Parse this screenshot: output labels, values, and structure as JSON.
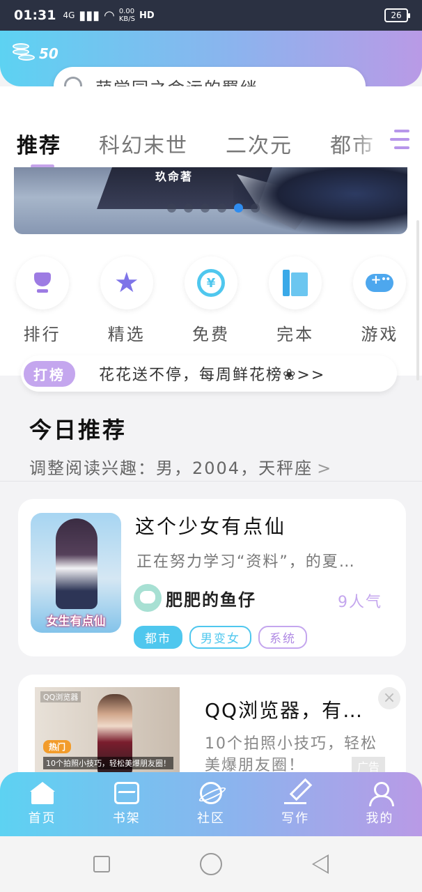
{
  "status_bar": {
    "time": "01:31",
    "network": "4G",
    "speed_value": "0.00",
    "speed_unit": "KB/S",
    "hd": "HD",
    "battery": "26"
  },
  "header": {
    "coins": "50",
    "search_placeholder": "萌学园之命运的羁绊"
  },
  "tabs": [
    {
      "label": "推荐",
      "active": true
    },
    {
      "label": "科幻末世"
    },
    {
      "label": "二次元"
    },
    {
      "label": "都市"
    }
  ],
  "banner": {
    "author_text": "玖命著",
    "dot_count": 6,
    "active_dot": 4
  },
  "quick_links": [
    {
      "label": "排行",
      "icon": "trophy-icon",
      "color": "#9d7be3"
    },
    {
      "label": "精选",
      "icon": "star-icon",
      "color": "#7e74e8"
    },
    {
      "label": "免费",
      "icon": "yuan-icon",
      "color": "#4fc7ee"
    },
    {
      "label": "完本",
      "icon": "book-icon",
      "color": "#3aa9e8"
    },
    {
      "label": "游戏",
      "icon": "gamepad-icon",
      "color": "#4da7ee"
    }
  ],
  "notice": {
    "tag": "打榜",
    "text": "花花送不停，每周鲜花榜❀>>"
  },
  "today": {
    "title": "今日推荐",
    "subtitle": "调整阅读兴趣：男，2004，天秤座",
    "chevron": ">"
  },
  "book_card": {
    "cover_text": "女生有点仙",
    "title": "这个少女有点仙",
    "description": "正在努力学习“资料”，的夏…",
    "author": "肥肥的鱼仔",
    "popularity": "9人气",
    "tags": [
      "都市",
      "男变女",
      "系统"
    ]
  },
  "ad_card": {
    "brand": "QQ浏览器",
    "hot_label": "热门",
    "image_caption": "10个拍照小技巧，轻松美爆朋友圈！",
    "title": "QQ浏览器，有…",
    "description": "10个拍照小技巧，轻松美爆朋友圈！",
    "close": "×",
    "ad_label": "广告"
  },
  "bottom_nav": [
    {
      "label": "首页",
      "icon": "home-icon"
    },
    {
      "label": "书架",
      "icon": "bookshelf-icon"
    },
    {
      "label": "社区",
      "icon": "community-icon"
    },
    {
      "label": "写作",
      "icon": "write-icon"
    },
    {
      "label": "我的",
      "icon": "profile-icon"
    }
  ],
  "colors": {
    "gradient_start": "#5dd2f2",
    "gradient_end": "#b99ae6",
    "accent_purple": "#c4a6ee",
    "accent_blue": "#4fc7ee"
  }
}
